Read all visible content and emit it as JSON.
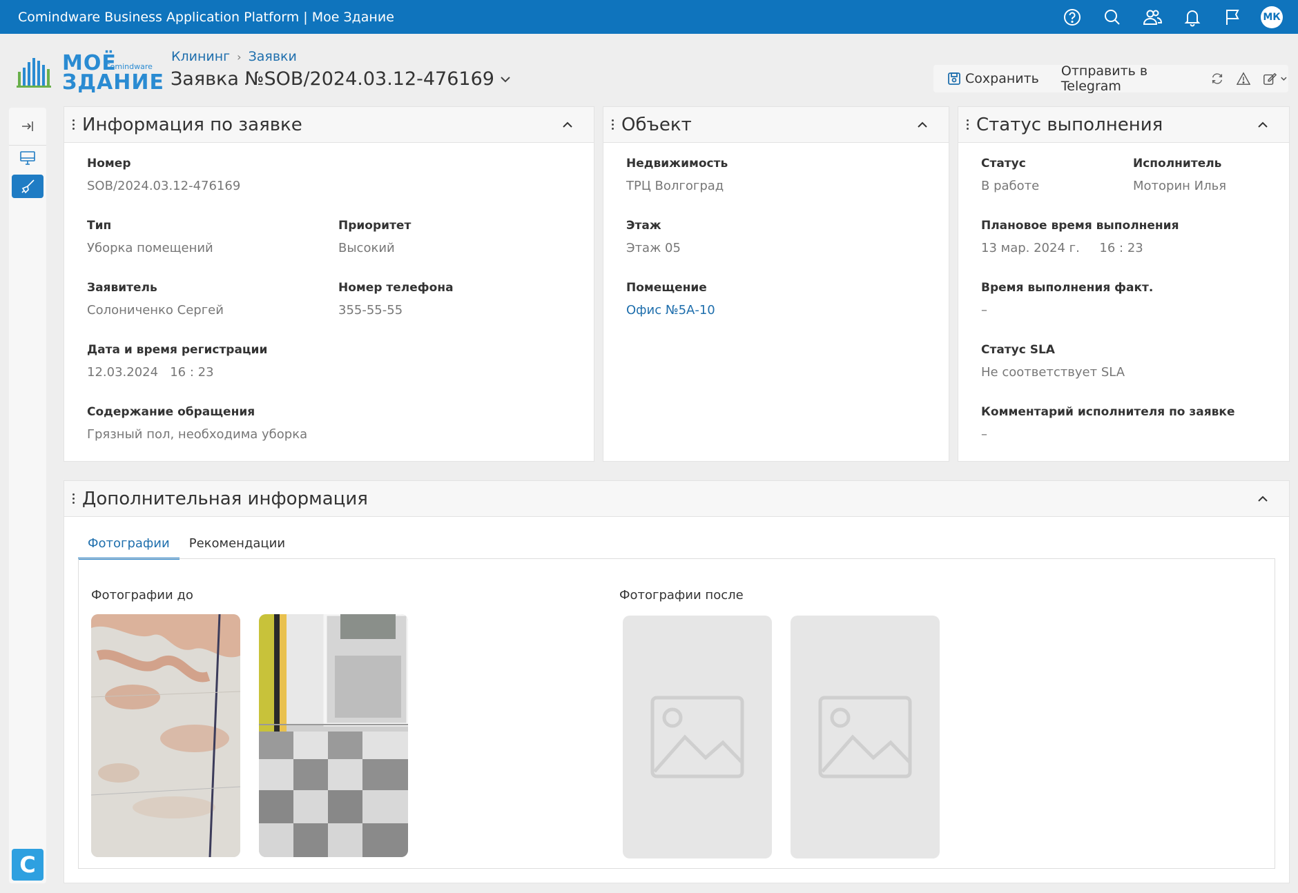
{
  "topbar": {
    "title": "Comindware Business Application Platform  |  Мое Здание",
    "icons": [
      "help-icon",
      "search-icon",
      "users-icon",
      "bell-icon",
      "flag-icon"
    ],
    "avatar": "МК",
    "color": "#0f74bd"
  },
  "logo": {
    "line1": "МОЁ",
    "line2": "ЗДАНИЕ",
    "brand": "Comindware"
  },
  "breadcrumb": {
    "item1": "Клининг",
    "item2": "Заявки"
  },
  "page_title": "Заявка №SOB/2024.03.12-476169",
  "toolbar": {
    "save": "Сохранить",
    "telegram": "Отправить в Telegram"
  },
  "panels": {
    "info": {
      "title": "Информация по заявке",
      "number_label": "Номер",
      "number": "SOB/2024.03.12-476169",
      "type_label": "Тип",
      "type": "Уборка помещений",
      "priority_label": "Приоритет",
      "priority": "Высокий",
      "applicant_label": "Заявитель",
      "applicant": "Солониченко Сергей",
      "phone_label": "Номер телефона",
      "phone": "355-55-55",
      "reg_label": "Дата и время регистрации",
      "reg": "12.03.2024   16 : 23",
      "content_label": "Содержание обращения",
      "content": "Грязный пол, необходима уборка"
    },
    "object": {
      "title": "Объект",
      "property_label": "Недвижимость",
      "property": "ТРЦ Волгоград",
      "floor_label": "Этаж",
      "floor": "Этаж 05",
      "room_label": "Помещение",
      "room": "Офис №5А-10"
    },
    "status": {
      "title": "Статус выполнения",
      "status_label": "Статус",
      "status": "В работе",
      "executor_label": "Исполнитель",
      "executor": "Моторин Илья",
      "planned_label": "Плановое время выполнения",
      "planned": "13 мар. 2024 г.     16 : 23",
      "actual_label": "Время выполнения факт.",
      "actual": "–",
      "sla_label": "Статус SLA",
      "sla": "Не соответствует SLA",
      "comment_label": "Комментарий исполнителя по заявке",
      "comment": "–"
    },
    "extra": {
      "title": "Дополнительная информация",
      "tabs": [
        "Фотографии",
        "Рекомендации"
      ],
      "before_label": "Фотографии до",
      "after_label": "Фотографии после"
    }
  }
}
